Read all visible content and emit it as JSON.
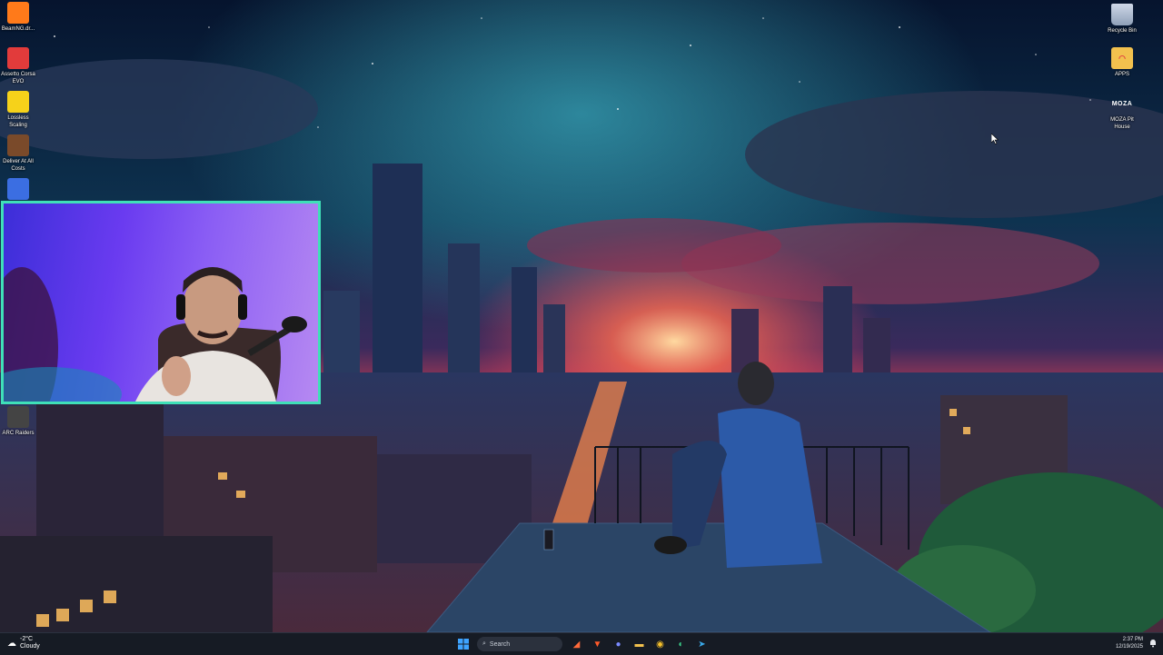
{
  "desktop": {
    "left_icons": [
      {
        "label": "BeamNG.dr...",
        "icon": "beamng-icon",
        "color": "#ff7a1a"
      },
      {
        "label": "Assetto Corsa EVO",
        "icon": "assetto-corsa-icon",
        "color": "#e23b3b"
      },
      {
        "label": "Lossless Scaling",
        "icon": "lossless-scaling-icon",
        "color": "#f6d21a"
      },
      {
        "label": "Deliver At All Costs",
        "icon": "deliver-at-all-costs-icon",
        "color": "#7a4a2a"
      },
      {
        "label": "",
        "icon": "partial-game-icon",
        "color": "#3b6ee2"
      },
      {
        "label": "ARC Raiders",
        "icon": "arc-raiders-icon",
        "color": "#444"
      }
    ],
    "right_icons": [
      {
        "label": "Recycle Bin",
        "icon": "recycle-bin-icon"
      },
      {
        "label": "APPS",
        "icon": "folder-icon"
      },
      {
        "label": "MOZA Pit House",
        "icon": "moza-icon",
        "glyph_text": "MOZA"
      }
    ]
  },
  "webcam": {
    "label": "streamer-webcam-overlay",
    "border_color": "#3fe0b8"
  },
  "taskbar": {
    "weather_temp": "-2°C",
    "weather_desc": "Cloudy",
    "search_placeholder": "Search",
    "apps": [
      "start-icon",
      "widget-icon",
      "game-launcher-icon",
      "brave-icon",
      "discord-icon",
      "file-explorer-icon",
      "chrome-icon",
      "edge-icon",
      "telegram-icon"
    ],
    "time": "2:37 PM",
    "date": "12/19/2025"
  }
}
